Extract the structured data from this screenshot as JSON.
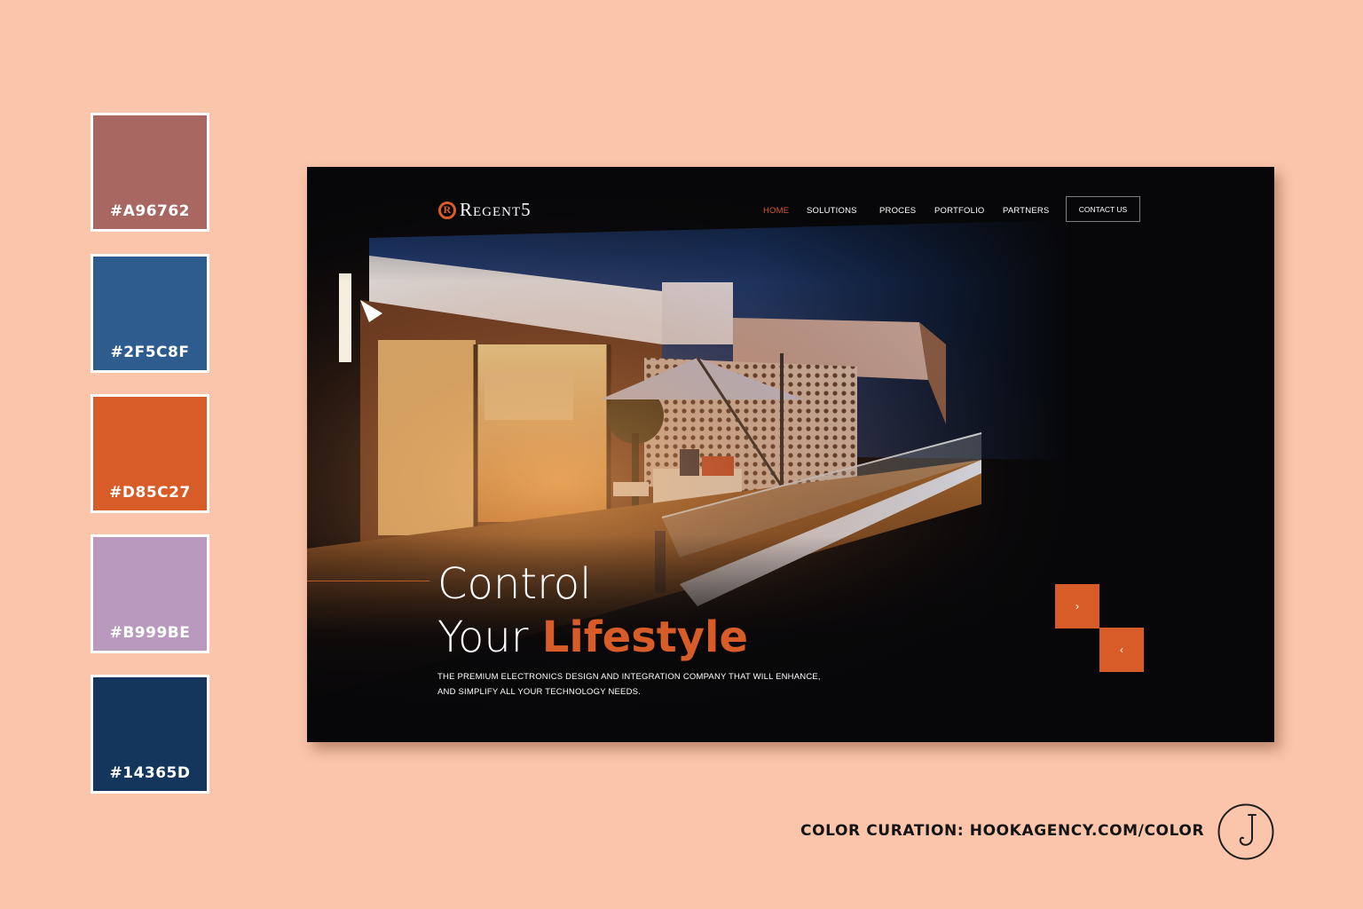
{
  "palette": [
    {
      "label": "#A96762",
      "color": "#A96762"
    },
    {
      "label": "#2F5C8F",
      "color": "#2F5C8F"
    },
    {
      "label": "#D85C27",
      "color": "#D85C27"
    },
    {
      "label": "#B999BE",
      "color": "#B999BE"
    },
    {
      "label": "#14365D",
      "color": "#14365D"
    }
  ],
  "site": {
    "logo_text": "Regent5",
    "logo_mark": "R",
    "nav": {
      "home": "HOME",
      "solutions": "SOLUTIONS",
      "proces": "PROCES",
      "portfolio": "PORTFOLIO",
      "partners": "PARTNERS",
      "contact": "CONTACT US"
    },
    "hero": {
      "line1": "Control",
      "line2_plain": "Your ",
      "line2_accent": "Lifestyle",
      "subtitle_line1": "THE PREMIUM ELECTRONICS DESIGN AND INTEGRATION  COMPANY THAT WILL ENHANCE,",
      "subtitle_line2": "AND SIMPLIFY ALL YOUR  TECHNOLOGY NEEDS."
    },
    "next_arrow": "›",
    "prev_arrow": "‹"
  },
  "credit": "COLOR CURATION: HOOKAGENCY.COM/COLOR",
  "colors": {
    "page_background": "#FAC5AA",
    "site_background": "#070709",
    "accent": "#D85C27"
  }
}
